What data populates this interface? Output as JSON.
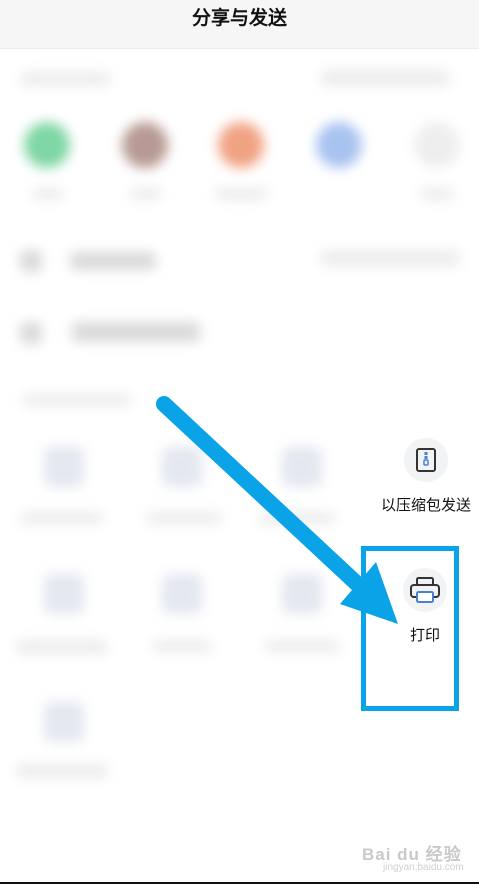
{
  "header": {
    "title": "分享与发送"
  },
  "options": {
    "zip_label": "以压缩包发送",
    "print_label": "打印"
  },
  "colors": {
    "accent": "#0aa3e8",
    "printer_icon": "#4a7fd6"
  },
  "watermark": {
    "brand": "Bai du 经验",
    "url": "jingyan.baidu.com"
  }
}
